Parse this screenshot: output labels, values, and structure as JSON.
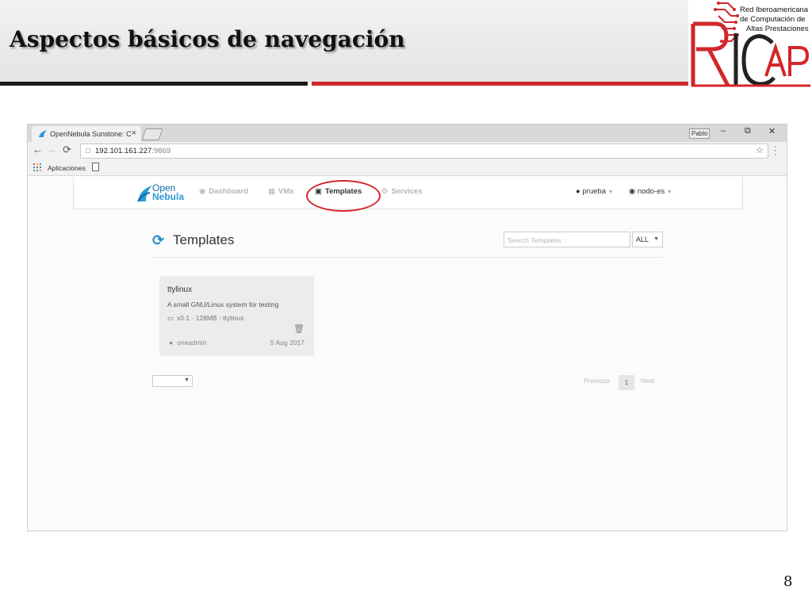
{
  "slide": {
    "title": "Aspectos básicos de navegación",
    "page_number": "8",
    "logo": {
      "line1": "Red Iberoamericana",
      "line2": "de Computación de",
      "line3": "Altas Prestaciones",
      "wordmark": "RICAP"
    }
  },
  "browser": {
    "tab_title": "OpenNebula Sunstone: C",
    "tab_close": "×",
    "user_chip": "Pablo",
    "url_host": "192.101.161.227",
    "url_port": ":9869",
    "bookmarks_label": "Aplicaciones"
  },
  "sunstone": {
    "logo_line1": "Open",
    "logo_line2": "Nebula",
    "nav": [
      {
        "label": "Dashboard",
        "icon": "dashboard-icon"
      },
      {
        "label": "VMs",
        "icon": "grid-icon"
      },
      {
        "label": "Templates",
        "icon": "save-icon"
      },
      {
        "label": "Services",
        "icon": "cogs-icon"
      }
    ],
    "user": "prueba",
    "zone": "nodo-es",
    "page_title": "Templates",
    "search_placeholder": "Search Templates",
    "filter_value": "ALL",
    "template_card": {
      "name": "ttylinux",
      "description": "A small GNU/Linux system for testing",
      "spec": "x0.1 - 128MB - ttylinux",
      "owner": "oneadmin",
      "date": "5 Aug 2017"
    },
    "pagination": {
      "previous": "Previous",
      "current": "1",
      "next": "Next"
    }
  },
  "colors": {
    "accent_red": "#d2262b",
    "opennebula_blue": "#2c9ad4",
    "refresh_blue": "#2c8fc9"
  }
}
